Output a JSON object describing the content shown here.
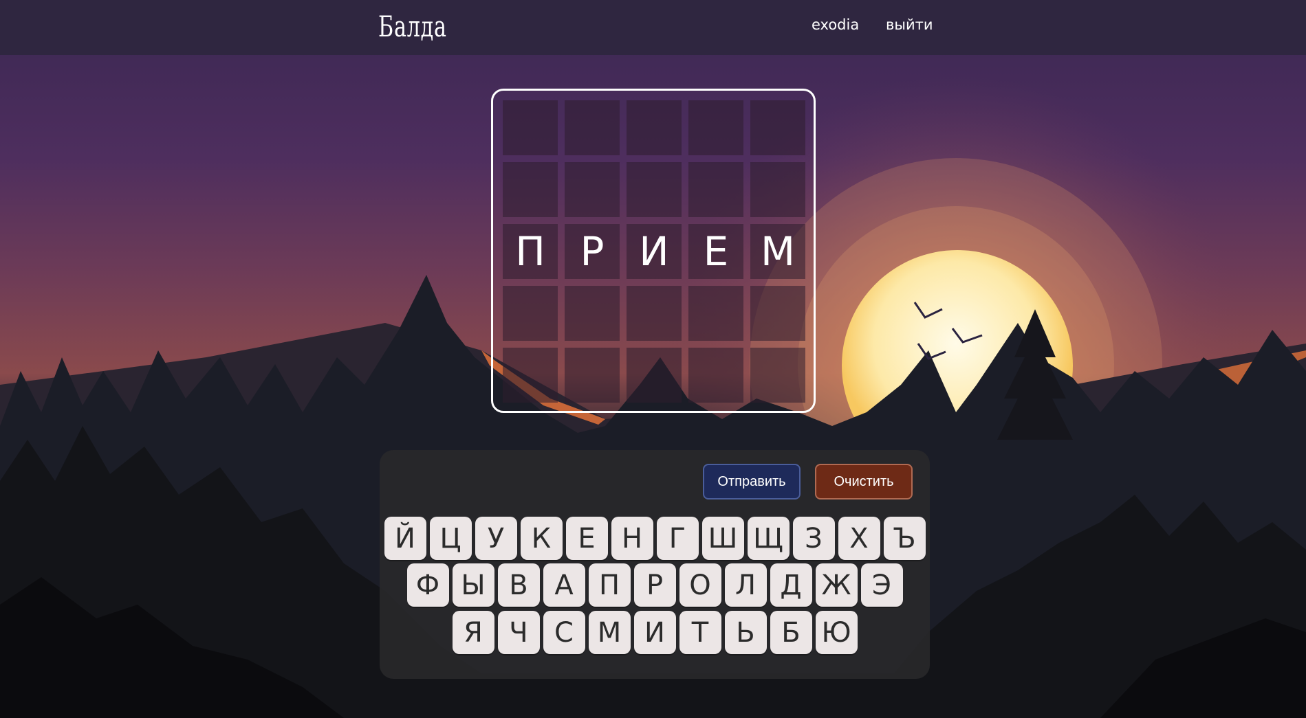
{
  "header": {
    "logo": "Балда",
    "username": "exodia",
    "logout": "выйти"
  },
  "board": {
    "rows": [
      [
        "",
        "",
        "",
        "",
        ""
      ],
      [
        "",
        "",
        "",
        "",
        ""
      ],
      [
        "П",
        "Р",
        "И",
        "Е",
        "М"
      ],
      [
        "",
        "",
        "",
        "",
        ""
      ],
      [
        "",
        "",
        "",
        "",
        ""
      ]
    ]
  },
  "controls": {
    "submit_label": "Отправить",
    "clear_label": "Очистить"
  },
  "keyboard": {
    "rows": [
      [
        "Й",
        "Ц",
        "У",
        "К",
        "Е",
        "Н",
        "Г",
        "Ш",
        "Щ",
        "З",
        "Х",
        "Ъ"
      ],
      [
        "Ф",
        "Ы",
        "В",
        "А",
        "П",
        "Р",
        "О",
        "Л",
        "Д",
        "Ж",
        "Э"
      ],
      [
        "Я",
        "Ч",
        "С",
        "М",
        "И",
        "Т",
        "Ь",
        "Б",
        "Ю"
      ]
    ]
  },
  "colors": {
    "topbar": "#2f2640",
    "sun": "#fbe7a8",
    "submit_button": "#1e2a5a",
    "clear_button": "#6e2a16",
    "key_background": "#ece6e6"
  }
}
